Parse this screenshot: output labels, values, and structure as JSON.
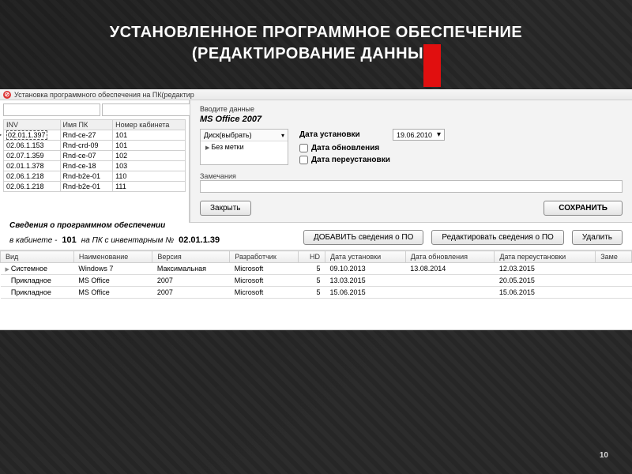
{
  "slide": {
    "title_line1": "УСТАНОВЛЕННОЕ ПРОГРАММНОЕ ОБЕСПЕЧЕНИЕ",
    "title_line2": "(РЕДАКТИРОВАНИЕ ДАННЫХ)",
    "page_number": "10"
  },
  "window": {
    "title": "Установка программного обеспечения на ПК(редактир"
  },
  "pc_table": {
    "headers": {
      "inv": "INV",
      "name": "Имя ПК",
      "room": "Номер кабинета"
    },
    "rows": [
      {
        "inv": "02.01.1.397",
        "name": "Rnd-ce-27",
        "room": "101",
        "selected": true
      },
      {
        "inv": "02.06.1.153",
        "name": "Rnd-crd-09",
        "room": "101"
      },
      {
        "inv": "02.07.1.359",
        "name": "Rnd-ce-07",
        "room": "102"
      },
      {
        "inv": "02.01.1.378",
        "name": "Rnd-ce-18",
        "room": "103"
      },
      {
        "inv": "02.06.1.218",
        "name": "Rnd-b2e-01",
        "room": "110"
      },
      {
        "inv": "02.06.1.218",
        "name": "Rnd-b2e-01",
        "room": "111"
      }
    ]
  },
  "dialog": {
    "prompt": "Вводите данные",
    "product": "MS Office 2007",
    "disk_header": "Диск(выбрать)",
    "disk_value": "Без метки",
    "install_date_label": "Дата установки",
    "install_date_value": "19.06.2010",
    "update_check_label": "Дата обновления",
    "reinstall_check_label": "Дата переустановки",
    "notes_label": "Замечания",
    "notes_value": "",
    "close_btn": "Закрыть",
    "save_btn": "СОХРАНИТЬ"
  },
  "info_bar": {
    "heading": "Сведения о программном обеспечении",
    "cabinet_label": "в кабинете -",
    "cabinet_value": "101",
    "pc_label": "на ПК с инвентарным №",
    "pc_value": "02.01.1.39",
    "add_btn": "ДОБАВИТЬ сведения о ПО",
    "edit_btn": "Редактировать сведения о ПО",
    "delete_btn": "Удалить"
  },
  "sw_table": {
    "headers": {
      "type": "Вид",
      "name": "Наименование",
      "version": "Версия",
      "vendor": "Разработчик",
      "hd": "HD",
      "install": "Дата установки",
      "update": "Дата обновления",
      "reinstall": "Дата переустановки",
      "note": "Заме"
    },
    "rows": [
      {
        "type": "Системное",
        "name": "Windows 7",
        "version": "Максимальная",
        "vendor": "Microsoft",
        "hd": "5",
        "install": "09.10.2013",
        "update": "13.08.2014",
        "reinstall": "12.03.2015",
        "current": true
      },
      {
        "type": "Прикладное",
        "name": "MS Office",
        "version": "2007",
        "vendor": "Microsoft",
        "hd": "5",
        "install": "13.03.2015",
        "update": "",
        "reinstall": "20.05.2015"
      },
      {
        "type": "Прикладное",
        "name": "MS Office",
        "version": "2007",
        "vendor": "Microsoft",
        "hd": "5",
        "install": "15.06.2015",
        "update": "",
        "reinstall": "15.06.2015"
      }
    ]
  }
}
